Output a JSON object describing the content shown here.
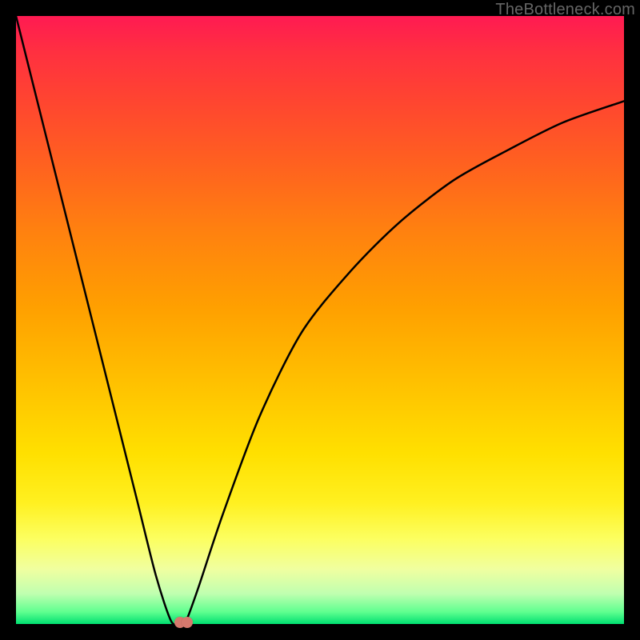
{
  "watermark": "TheBottleneck.com",
  "chart_data": {
    "type": "line",
    "title": "",
    "xlabel": "",
    "ylabel": "",
    "xlim": [
      0,
      100
    ],
    "ylim": [
      0,
      100
    ],
    "grid": false,
    "legend": false,
    "series": [
      {
        "name": "bottleneck-curve",
        "x": [
          0,
          2,
          5,
          8,
          11,
          14,
          17,
          20,
          23,
          25.5,
          27,
          27.5,
          28,
          30,
          34,
          40,
          47,
          55,
          63,
          72,
          81,
          90,
          100
        ],
        "y": [
          100,
          92,
          80,
          68,
          56,
          44,
          32,
          20,
          8,
          0.5,
          0,
          0,
          0.5,
          6,
          18,
          34,
          48,
          58,
          66,
          73,
          78,
          82.5,
          86
        ]
      }
    ],
    "markers": [
      {
        "name": "pink-dot-a",
        "x": 27.0,
        "y": 0.3
      },
      {
        "name": "pink-dot-b",
        "x": 28.2,
        "y": 0.3
      }
    ],
    "gradient_stops": [
      {
        "pos": 0,
        "color": "#ff1a52"
      },
      {
        "pos": 50,
        "color": "#ffa000"
      },
      {
        "pos": 85,
        "color": "#fcff60"
      },
      {
        "pos": 100,
        "color": "#00e070"
      }
    ]
  }
}
